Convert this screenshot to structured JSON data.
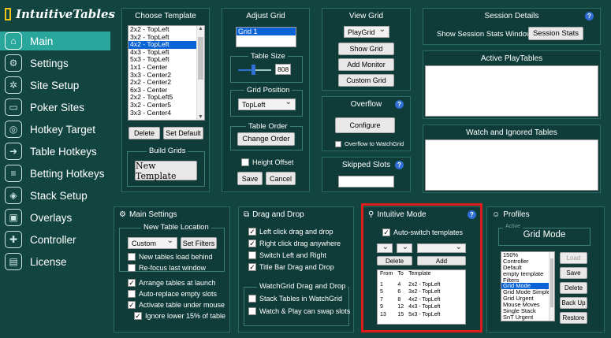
{
  "app": {
    "logo_text": "IntuitiveTables"
  },
  "sidebar": {
    "items": [
      {
        "label": "Main",
        "icon": "home-icon",
        "active": true
      },
      {
        "label": "Settings",
        "icon": "gear-icon"
      },
      {
        "label": "Site Setup",
        "icon": "gears-icon"
      },
      {
        "label": "Poker Sites",
        "icon": "monitor-icon"
      },
      {
        "label": "Hotkey Target",
        "icon": "target-icon"
      },
      {
        "label": "Table Hotkeys",
        "icon": "arrow-circle-icon"
      },
      {
        "label": "Betting Hotkeys",
        "icon": "database-icon"
      },
      {
        "label": "Stack Setup",
        "icon": "layers-icon"
      },
      {
        "label": "Overlays",
        "icon": "overlays-icon"
      },
      {
        "label": "Controller",
        "icon": "gamepad-icon"
      },
      {
        "label": "License",
        "icon": "license-icon"
      }
    ]
  },
  "choose_template": {
    "title": "Choose Template",
    "items": [
      "2x2 - TopLeft",
      "3x2 - TopLeft",
      "4x2 - TopLeft",
      "4x3 - TopLeft",
      "5x3 - TopLeft",
      "1x1 - Center",
      "3x3 - Center2",
      "2x2 - Center2",
      "6x3 - Center",
      "2x2 - TopLeft5",
      "3x2 - Center5",
      "3x3 - Center4"
    ],
    "selected_index": 2,
    "delete_label": "Delete",
    "set_default_label": "Set Default",
    "build_grids_label": "Build Grids",
    "new_template_label": "New Template"
  },
  "adjust_grid": {
    "title": "Adjust Grid",
    "grid_name": "Grid 1",
    "table_size_label": "Table Size",
    "table_size_value": "808",
    "table_size_fraction": 0.45,
    "grid_position_label": "Grid Position",
    "grid_position_value": "TopLeft",
    "table_order_label": "Table Order",
    "change_order_label": "Change Order",
    "height_offset_label": "Height Offset",
    "save_label": "Save",
    "cancel_label": "Cancel"
  },
  "view_grid": {
    "title": "View Grid",
    "playgrid_value": "PlayGrid",
    "show_grid_label": "Show Grid",
    "add_monitor_label": "Add Monitor",
    "custom_grid_label": "Custom Grid"
  },
  "overflow": {
    "title": "Overflow",
    "configure_label": "Configure",
    "overflow_to_watchgrid_label": "Overflow to WatchGrid"
  },
  "skipped_slots": {
    "title": "Skipped Slots"
  },
  "session_details": {
    "title": "Session Details",
    "show_stats_label": "Show Session Stats Window:",
    "session_stats_button": "Session Stats"
  },
  "active_playtables": {
    "title": "Active PlayTables"
  },
  "watch_ignored": {
    "title": "Watch and Ignored Tables"
  },
  "main_settings": {
    "title": "Main Settings",
    "new_table_location_label": "New Table Location",
    "location_value": "Custom",
    "set_filters_label": "Set Filters",
    "checks": [
      {
        "label": "New tables load behind",
        "checked": false
      },
      {
        "label": "Re-focus last window",
        "checked": false
      },
      {
        "label": "Arrange tables at launch",
        "checked": true
      },
      {
        "label": "Auto-replace empty slots",
        "checked": false
      },
      {
        "label": "Activate table under mouse",
        "checked": true
      },
      {
        "label": "Ignore lower 15% of table",
        "checked": true
      }
    ]
  },
  "drag_drop": {
    "title": "Drag and Drop",
    "checks": [
      {
        "label": "Left click drag and drop",
        "checked": true
      },
      {
        "label": "Right click drag anywhere",
        "checked": true
      },
      {
        "label": "Switch Left and Right",
        "checked": false
      },
      {
        "label": "Title Bar Drag and Drop",
        "checked": true
      }
    ],
    "watchgrid_label": "WatchGrid Drag and Drop",
    "watch_checks": [
      {
        "label": "Stack Tables in WatchGrid",
        "checked": false
      },
      {
        "label": "Watch & Play can swap slots",
        "checked": false
      }
    ]
  },
  "intuitive_mode": {
    "title": "Intuitive Mode",
    "auto_switch_label": "Auto-switch templates",
    "delete_label": "Delete",
    "add_label": "Add",
    "headers": [
      "From",
      "To",
      "Template"
    ],
    "rows": [
      [
        "1",
        "4",
        "2x2 - TopLeft"
      ],
      [
        "5",
        "6",
        "3x2 - TopLeft"
      ],
      [
        "7",
        "8",
        "4x2 - TopLeft"
      ],
      [
        "9",
        "12",
        "4x3 - TopLeft"
      ],
      [
        "13",
        "15",
        "5x3 - TopLeft"
      ]
    ]
  },
  "profiles": {
    "title": "Profiles",
    "active_label": "Active",
    "active_value": "Grid Mode",
    "items": [
      "150%",
      "Controller",
      "Default",
      "empty template",
      "Filters",
      "Grid Mode",
      "Grid Mode Simple",
      "Grid Urgent",
      "Mouse Moves",
      "Single Stack",
      "SnT Urgent"
    ],
    "selected_index": 5,
    "load_label": "Load",
    "save_label": "Save",
    "delete_label": "Delete",
    "backup_label": "Back Up",
    "restore_label": "Restore"
  },
  "colors": {
    "accent": "#2aa79c",
    "background": "#124540",
    "panel": "#0f3c38",
    "highlight": "#e01b1b"
  }
}
